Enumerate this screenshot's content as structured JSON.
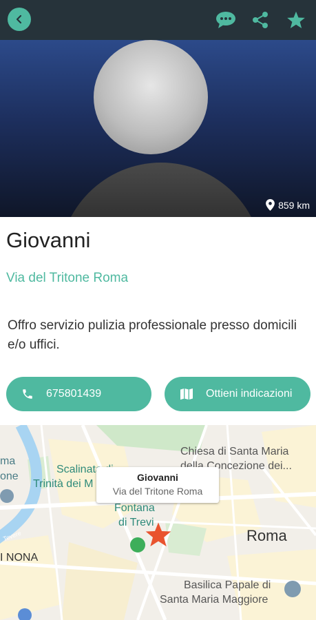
{
  "header": {
    "back_icon": "chevron-left-icon",
    "actions": [
      "chat-icon",
      "share-icon",
      "star-icon"
    ],
    "accent_color": "#4fb9a0",
    "bg_color": "#26333a"
  },
  "profile": {
    "distance": "859 km",
    "name": "Giovanni",
    "address": "Via del Tritone Roma",
    "description": "Offro servizio pulizia professionale presso domicili e/o uffici."
  },
  "actions": {
    "call_label": "675801439",
    "directions_label": "Ottieni indicazioni"
  },
  "map": {
    "callout_title": "Giovanni",
    "callout_subtitle": "Via del Tritone Roma",
    "labels": {
      "scalinata": "Scalinata di",
      "trinita": "Trinità dei M",
      "fontana": "Fontana",
      "trevi": "di Trevi",
      "roma": "Roma",
      "chiesa1": "Chiesa di Santa Maria",
      "chiesa2": "della Concezione dei...",
      "basilica1": "Basilica Papale di",
      "basilica2": "Santa Maria Maggiore",
      "rione": "I NONA",
      "edge1": "ma",
      "edge2": "one",
      "tevere": "Tevere"
    }
  }
}
